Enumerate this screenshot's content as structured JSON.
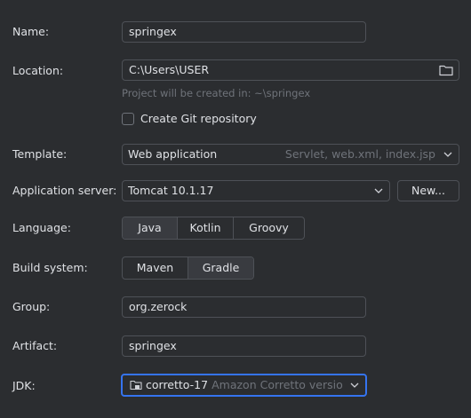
{
  "name": {
    "label": "Name:",
    "value": "springex"
  },
  "location": {
    "label": "Location:",
    "value": "C:\\Users\\USER",
    "hint": "Project will be created in: ~\\springex",
    "folder_icon": "folder-icon"
  },
  "git": {
    "label": "Create Git repository",
    "checked": false
  },
  "template": {
    "label": "Template:",
    "value": "Web application",
    "detail": "Servlet, web.xml, index.jsp"
  },
  "app_server": {
    "label": "Application server:",
    "value": "Tomcat 10.1.17",
    "new_button": "New..."
  },
  "language": {
    "label": "Language:",
    "options": [
      "Java",
      "Kotlin",
      "Groovy"
    ],
    "selected": "Java"
  },
  "build_system": {
    "label": "Build system:",
    "options": [
      "Maven",
      "Gradle"
    ],
    "selected": "Gradle"
  },
  "group": {
    "label": "Group:",
    "value": "org.zerock"
  },
  "artifact": {
    "label": "Artifact:",
    "value": "springex"
  },
  "jdk": {
    "label": "JDK:",
    "value": "corretto-17",
    "detail": "Amazon Corretto versio"
  },
  "colors": {
    "background": "#2b2d30",
    "border": "#4e5157",
    "focus": "#3574f0",
    "hint": "#6f737a",
    "selected_segment": "#393b40"
  }
}
